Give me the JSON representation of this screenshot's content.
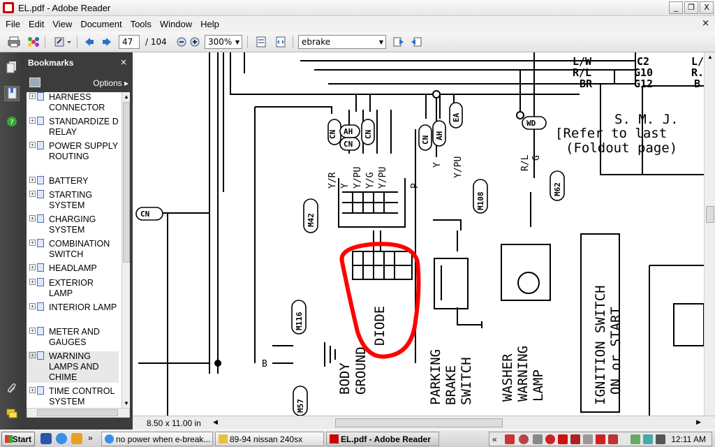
{
  "window": {
    "title": "EL.pdf - Adobe Reader",
    "minimize": "_",
    "restore": "❐",
    "close": "X"
  },
  "menu": [
    "File",
    "Edit",
    "View",
    "Document",
    "Tools",
    "Window",
    "Help"
  ],
  "toolbar": {
    "page_current": "47",
    "page_total": "/ 104",
    "zoom": "300%",
    "search": "ebrake"
  },
  "bookmarks": {
    "title": "Bookmarks",
    "options": "Options",
    "items": [
      {
        "label": "HARNESS CONNECTOR"
      },
      {
        "label": "STANDARDIZE D RELAY"
      },
      {
        "label": "POWER SUPPLY ROUTING"
      },
      {
        "label": "BATTERY"
      },
      {
        "label": "STARTING SYSTEM"
      },
      {
        "label": "CHARGING SYSTEM"
      },
      {
        "label": "COMBINATION SWITCH"
      },
      {
        "label": "HEADLAMP"
      },
      {
        "label": "EXTERIOR LAMP"
      },
      {
        "label": "INTERIOR LAMP"
      },
      {
        "label": "METER AND GAUGES"
      },
      {
        "label": "WARNING LAMPS AND CHIME"
      },
      {
        "label": "TIME CONTROL SYSTEM"
      }
    ]
  },
  "diagram": {
    "labels": {
      "lw": "L/W",
      "rl": "R/L",
      "br": "BR",
      "c2": "C2",
      "g10": "G10",
      "g12": "G12",
      "l_right": "L/",
      "r_right": "R.",
      "b_right": "B",
      "smj": "S. M. J.",
      "refer": "[Refer to last",
      "foldout": "(Foldout page)",
      "cn": "CN",
      "ah": "AH",
      "ea": "EA",
      "wd": "WD",
      "m42": "M42",
      "m108": "M108",
      "m62": "M62",
      "m116": "M116",
      "m57": "M57",
      "wire_yr": "Y/R",
      "wire_y": "Y",
      "wire_ypu": "Y/PU",
      "wire_yg": "Y/G",
      "wire_ypu2": "Y/PU",
      "wire_p": "P",
      "wire_y2": "Y",
      "wire_ypu3": "Y/PU",
      "wire_rl": "R/L",
      "wire_g": "G",
      "wire_b": "B",
      "diode": "DIODE",
      "body_ground": "BODY",
      "ground": "GROUND",
      "parking": "PARKING",
      "brake": "BRAKE",
      "switch": "SWITCH",
      "washer": "WASHER",
      "warning": "WARNING",
      "lamp": "LAMP",
      "ignition": "IGNITION SWITCH",
      "on_start": "ON or START"
    },
    "highlight_color": "#ff0000"
  },
  "status": {
    "page_size": "8.50 x 11.00 in"
  },
  "taskbar": {
    "start": "Start",
    "tasks": [
      {
        "label": "no power when e-break..."
      },
      {
        "label": "89-94 nissan 240sx"
      },
      {
        "label": "EL.pdf - Adobe Reader"
      }
    ],
    "overflow": "»",
    "tray_overflow": "«",
    "clock": "12:11 AM"
  }
}
